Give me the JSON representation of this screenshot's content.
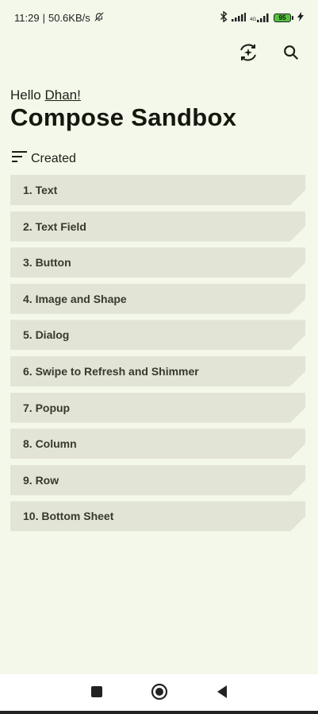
{
  "status_bar": {
    "time": "11:29",
    "separator": "|",
    "speed": "50.6KB/s",
    "battery": "95",
    "network": "4G"
  },
  "header": {
    "greeting_prefix": "Hello ",
    "user_name": "Dhan!",
    "title": "Compose Sandbox"
  },
  "sort": {
    "label": "Created"
  },
  "items": [
    {
      "label": "1. Text"
    },
    {
      "label": "2. Text Field"
    },
    {
      "label": "3. Button"
    },
    {
      "label": "4. Image and Shape"
    },
    {
      "label": "5. Dialog"
    },
    {
      "label": "6. Swipe to Refresh and Shimmer"
    },
    {
      "label": "7. Popup"
    },
    {
      "label": "8. Column"
    },
    {
      "label": "9. Row"
    },
    {
      "label": "10. Bottom Sheet"
    }
  ],
  "icons": {
    "refresh_sparkle": "refresh-sparkle-icon",
    "search": "search-icon",
    "sort": "sort-icon",
    "bell_off": "bell-off-icon",
    "bluetooth": "bluetooth-icon",
    "signal": "signal-icon",
    "battery": "battery-icon",
    "charging": "charging-icon",
    "nav_square": "recent-apps-icon",
    "nav_circle": "home-icon",
    "nav_back": "back-icon"
  },
  "colors": {
    "background": "#f3f8ea",
    "item_background": "#e2e4d6",
    "item_text": "#363a2e",
    "battery": "#54c23e"
  }
}
